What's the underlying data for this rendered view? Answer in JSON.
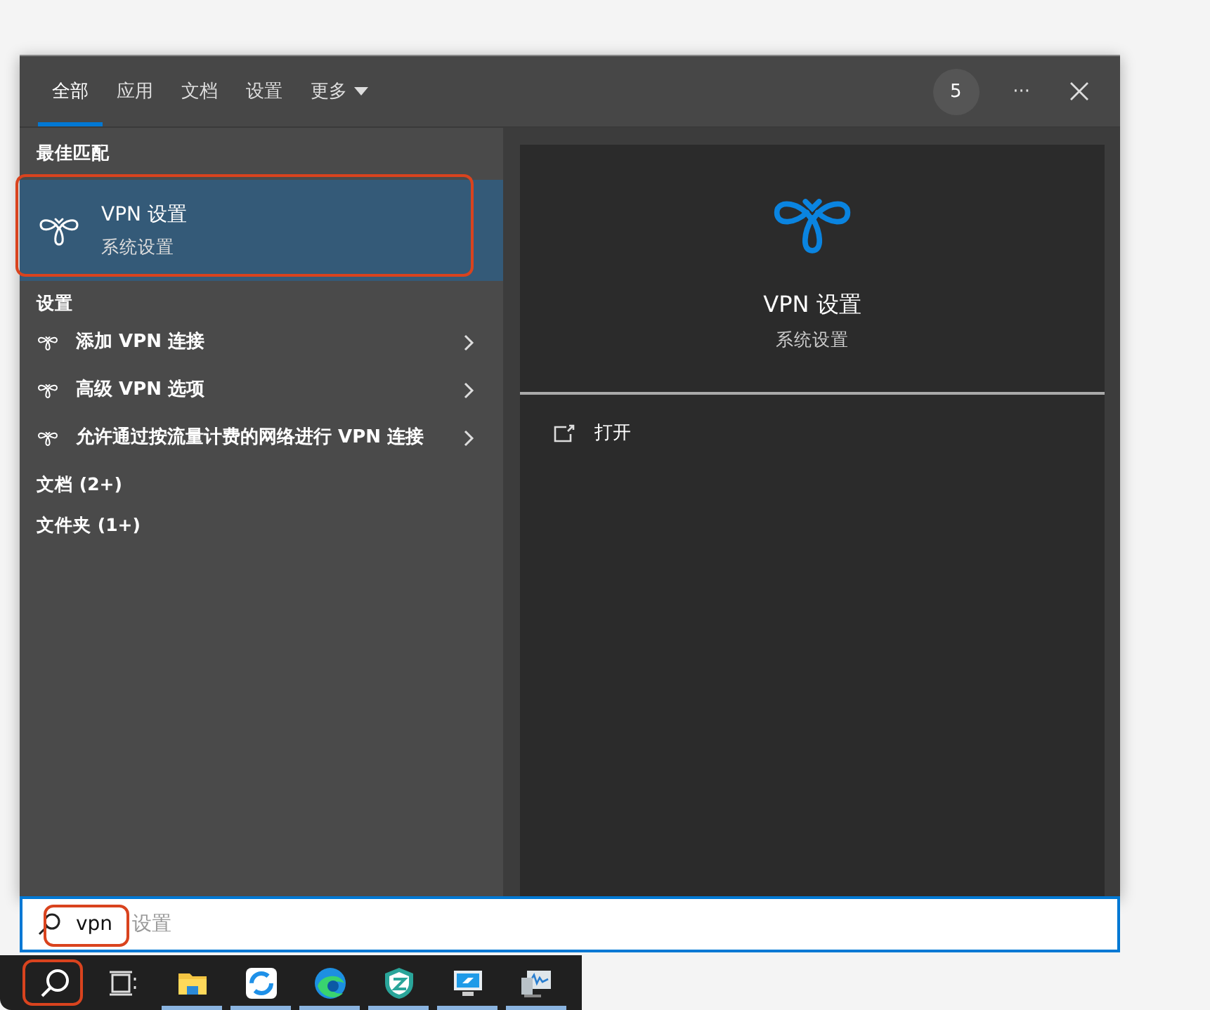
{
  "tabs": [
    {
      "label": "全部",
      "selected": true
    },
    {
      "label": "应用",
      "selected": false
    },
    {
      "label": "文档",
      "selected": false
    },
    {
      "label": "设置",
      "selected": false
    },
    {
      "label": "更多",
      "selected": false,
      "kind": "dropdown"
    }
  ],
  "header": {
    "badge": "5",
    "more": "···"
  },
  "best_match": {
    "heading": "最佳匹配",
    "title": "VPN 设置",
    "subtitle": "系统设置",
    "selected": true,
    "highlighted": true
  },
  "settings": {
    "heading": "设置",
    "items": [
      {
        "label": "添加 VPN 连接"
      },
      {
        "label": "高级 VPN 选项"
      },
      {
        "label": "允许通过按流量计费的网络进行 VPN 连接"
      }
    ]
  },
  "groups": [
    {
      "label": "文档 (2+)"
    },
    {
      "label": "文件夹 (1+)"
    }
  ],
  "preview": {
    "title": "VPN 设置",
    "subtitle": "系统设置",
    "actions": [
      {
        "label": "打开"
      }
    ]
  },
  "search": {
    "value": "vpn",
    "completion": "设置",
    "highlighted": true
  },
  "taskbar": {
    "search_highlighted": true,
    "apps": [
      {
        "kind": "task-view",
        "running": false
      },
      {
        "kind": "folder",
        "running": true
      },
      {
        "kind": "sync",
        "running": true
      },
      {
        "kind": "browser",
        "running": true
      },
      {
        "kind": "shield",
        "running": true
      },
      {
        "kind": "monitor",
        "running": true
      },
      {
        "kind": "performance",
        "running": true
      }
    ]
  }
}
